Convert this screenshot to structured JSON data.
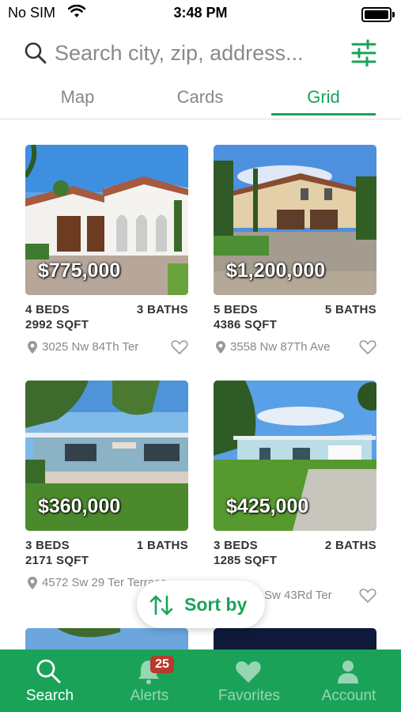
{
  "status_bar": {
    "carrier": "No SIM",
    "time": "3:48 PM"
  },
  "search": {
    "placeholder": "Search city, zip, address..."
  },
  "tabs": [
    {
      "label": "Map",
      "active": false
    },
    {
      "label": "Cards",
      "active": false
    },
    {
      "label": "Grid",
      "active": true
    }
  ],
  "listings": [
    {
      "price": "$775,000",
      "beds": "4 BEDS",
      "baths": "3 BATHS",
      "sqft": "2992 SQFT",
      "address": "3025 Nw 84Th Ter"
    },
    {
      "price": "$1,200,000",
      "beds": "5 BEDS",
      "baths": "5 BATHS",
      "sqft": "4386 SQFT",
      "address": "3558 Nw 87Th Ave"
    },
    {
      "price": "$360,000",
      "beds": "3 BEDS",
      "baths": "1 BATHS",
      "sqft": "2171 SQFT",
      "address": "4572 Sw 29 Ter Terrace"
    },
    {
      "price": "$425,000",
      "beds": "3 BEDS",
      "baths": "2 BATHS",
      "sqft": "1285 SQFT",
      "address": "Sw 43Rd Ter"
    }
  ],
  "sort_button": {
    "label": "Sort by"
  },
  "bottom_nav": [
    {
      "label": "Search",
      "icon": "search-icon",
      "active": true
    },
    {
      "label": "Alerts",
      "icon": "bell-icon",
      "badge": "25",
      "active": false
    },
    {
      "label": "Favorites",
      "icon": "heart-icon",
      "active": false
    },
    {
      "label": "Account",
      "icon": "person-icon",
      "active": false
    }
  ],
  "colors": {
    "accent": "#1aa358",
    "badge": "#b83a2c"
  }
}
